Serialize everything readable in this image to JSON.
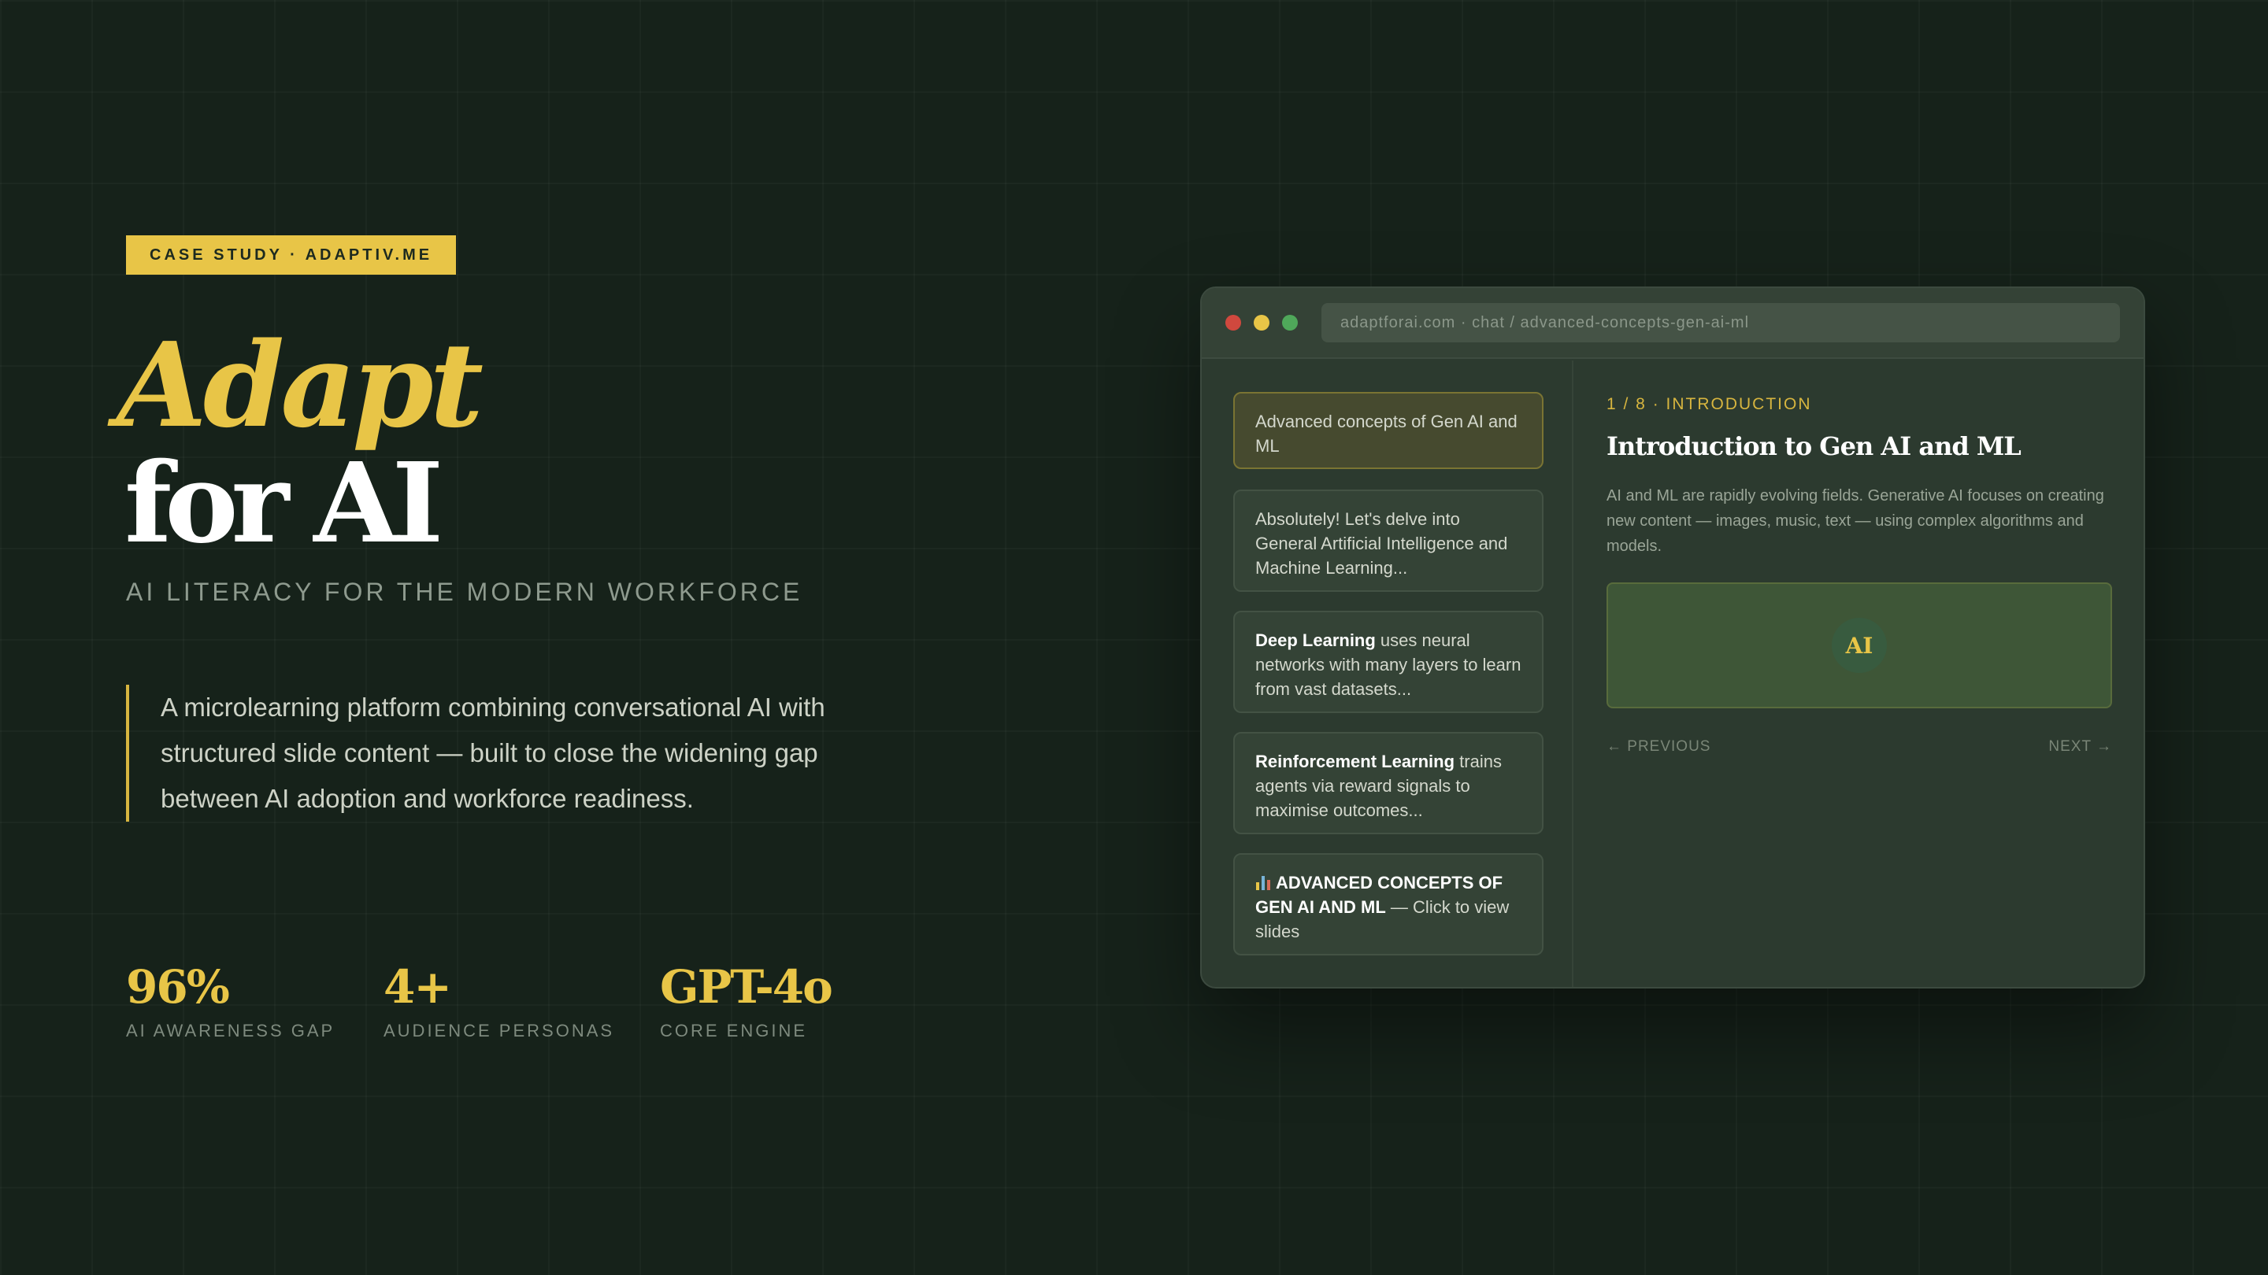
{
  "tag": "CASE STUDY · ADAPTIV.ME",
  "hero": {
    "title_line1": "Adapt",
    "title_line2": "for AI",
    "subtitle": "AI LITERACY FOR THE MODERN WORKFORCE",
    "description": "A microlearning platform combining conversational AI with structured slide content — built to close the widening gap between AI adoption and workforce readiness."
  },
  "stats": [
    {
      "value": "96%",
      "label": "AI AWARENESS GAP"
    },
    {
      "value": "4+",
      "label": "AUDIENCE PERSONAS"
    },
    {
      "value": "GPT-4o",
      "label": "CORE ENGINE"
    }
  ],
  "browser": {
    "url": "adaptforai.com · chat / advanced-concepts-gen-ai-ml",
    "chat": [
      {
        "text": "Advanced concepts of Gen AI and ML"
      },
      {
        "text": "Absolutely! Let's delve into General Artificial Intelligence and Machine Learning..."
      },
      {
        "bold": "Deep Learning",
        "text": " uses neural networks with many layers to learn from vast datasets..."
      },
      {
        "bold": "Reinforcement Learning",
        "text": " trains agents via reward signals to maximise outcomes..."
      },
      {
        "icon": "bar-chart-icon",
        "bold": "ADVANCED CONCEPTS OF GEN AI AND ML",
        "text": " — Click to view slides"
      }
    ],
    "slide": {
      "meta": "1 / 8 · INTRODUCTION",
      "title": "Introduction to Gen AI and ML",
      "body": "AI and ML are rapidly evolving fields. Generative AI focuses on creating new content — images, music, text — using complex algorithms and models.",
      "badge": "AI",
      "prev": "← PREVIOUS",
      "next": "NEXT →"
    }
  },
  "colors": {
    "background": "#16221a",
    "accent": "#e8c547",
    "panel": "#2c3a2f"
  }
}
